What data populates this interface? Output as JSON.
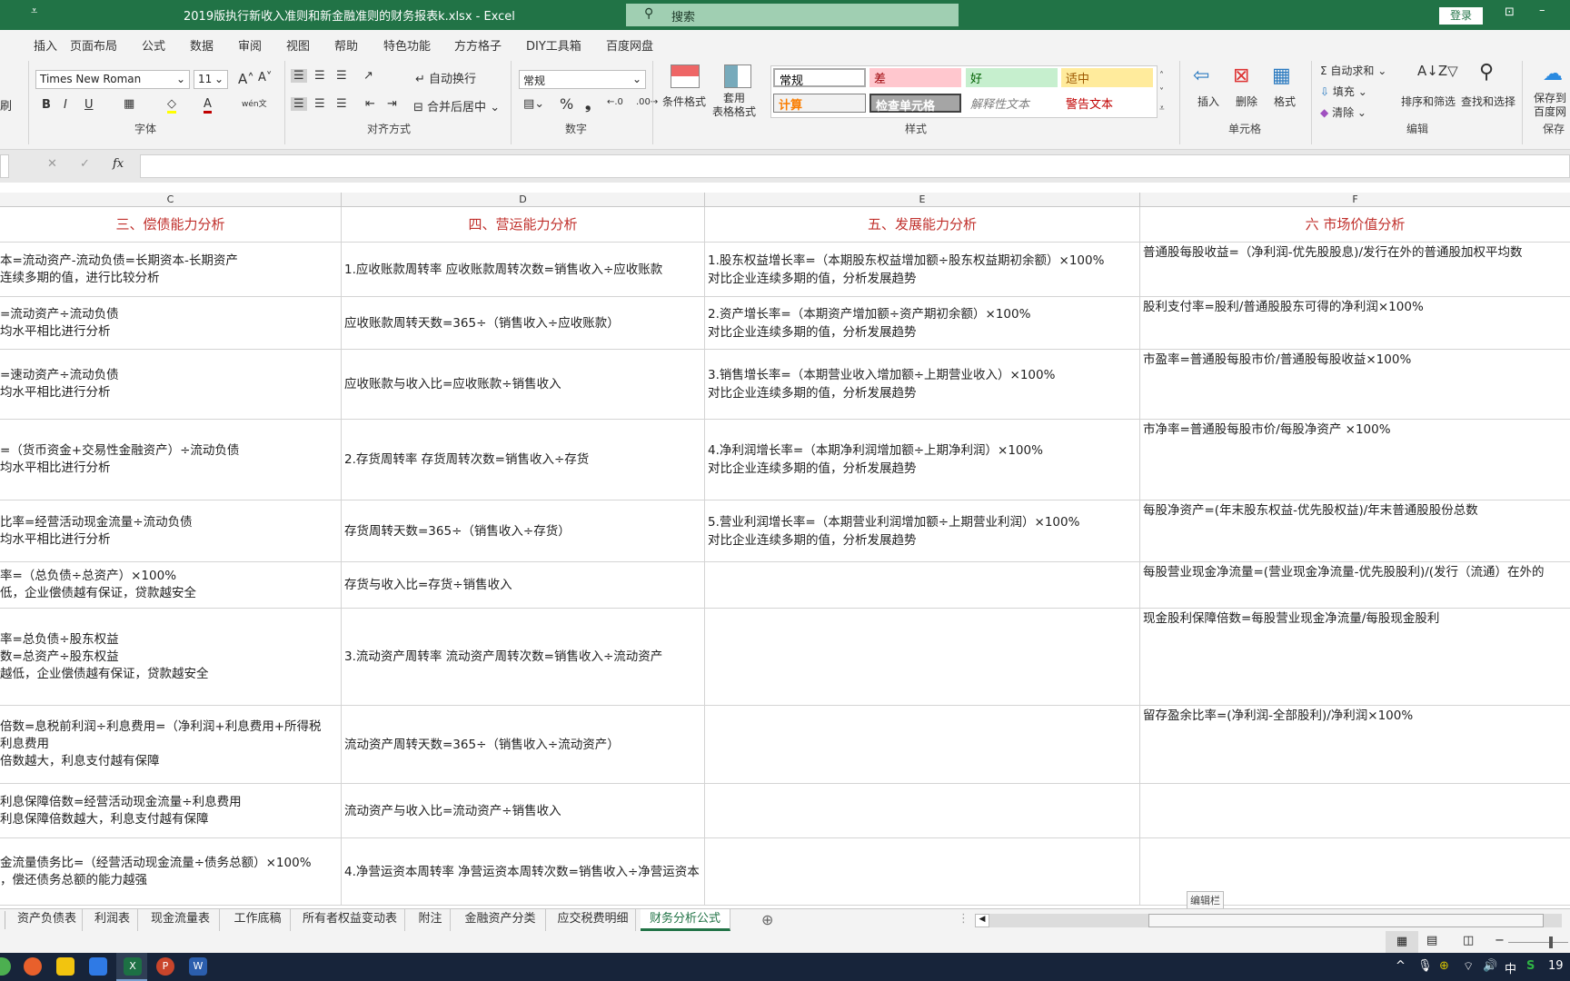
{
  "titlebar": {
    "title": "2019版执行新收入准则和新金融准则的财务报表k.xlsx  -  Excel",
    "search_placeholder": "搜索",
    "login": "登录",
    "qat_icon": "customize-qat-icon"
  },
  "menu": [
    "插入",
    "页面布局",
    "公式",
    "数据",
    "审阅",
    "视图",
    "帮助",
    "特色功能",
    "方方格子",
    "DIY工具箱",
    "百度网盘"
  ],
  "ribbon": {
    "clipboard_partial": "刷",
    "font": {
      "name": "Times New Roman",
      "size": "11",
      "group": "字体",
      "bold": "B",
      "italic": "I",
      "underline": "U",
      "wen": "wén文"
    },
    "alignment": {
      "wrap": "自动换行",
      "merge": "合并后居中",
      "group": "对齐方式"
    },
    "number": {
      "format": "常规",
      "percent": "%",
      "comma": "❟",
      "group": "数字"
    },
    "styles": {
      "cond_format": "条件格式",
      "table_format": "套用\n表格格式",
      "group": "样式",
      "gallery": [
        {
          "label": "常规",
          "bg": "#ffffff",
          "fg": "#000000"
        },
        {
          "label": "差",
          "bg": "#ffc7ce",
          "fg": "#9c0006"
        },
        {
          "label": "好",
          "bg": "#c6efce",
          "fg": "#006100"
        },
        {
          "label": "适中",
          "bg": "#ffeb9c",
          "fg": "#9c5700"
        },
        {
          "label": "计算",
          "bg": "#f2f2f2",
          "fg": "#fa7d00"
        },
        {
          "label": "检查单元格",
          "bg": "#a5a5a5",
          "fg": "#ffffff"
        },
        {
          "label": "解释性文本",
          "bg": "#ffffff",
          "fg": "#7f7f7f"
        },
        {
          "label": "警告文本",
          "bg": "#ffffff",
          "fg": "#c00000"
        }
      ]
    },
    "cells": {
      "insert": "插入",
      "delete": "删除",
      "format": "格式",
      "group": "单元格"
    },
    "editing": {
      "autosum": "自动求和",
      "fill": "填充",
      "clear": "清除",
      "sort": "排序和筛选",
      "find": "查找和选择",
      "group": "编辑"
    },
    "save": {
      "label": "保存到\n百度网",
      "group": "保存"
    }
  },
  "formula_bar": {
    "fx": "fx",
    "cancel": "✕",
    "enter": "✓",
    "value": ""
  },
  "columns": [
    "C",
    "D",
    "E",
    "F"
  ],
  "headers": [
    "三、偿债能力分析",
    "四、营运能力分析",
    "五、发展能力分析",
    "六 市场价值分析"
  ],
  "rows": [
    {
      "c": [
        "本=流动资产-流动负债=长期资本-长期资产",
        "连续多期的值，进行比较分析"
      ],
      "d": "1.应收账款周转率 应收账款周转次数=销售收入÷应收账款",
      "e": [
        "1.股东权益增长率=（本期股东权益增加额÷股东权益期初余额）×100%",
        "对比企业连续多期的值，分析发展趋势"
      ],
      "f": "普通股每股收益=（净利润-优先股股息)/发行在外的普通股加权平均数"
    },
    {
      "c": [
        "=流动资产÷流动负债",
        "均水平相比进行分析"
      ],
      "d": "应收账款周转天数=365÷（销售收入÷应收账款）",
      "e": [
        "2.资产增长率=（本期资产增加额÷资产期初余额）×100%",
        "对比企业连续多期的值，分析发展趋势"
      ],
      "f": "股利支付率=股利/普通股股东可得的净利润×100%"
    },
    {
      "c": [
        "=速动资产÷流动负债",
        "均水平相比进行分析"
      ],
      "d": "应收账款与收入比=应收账款÷销售收入",
      "e": [
        "3.销售增长率=（本期营业收入增加额÷上期营业收入）×100%",
        "对比企业连续多期的值，分析发展趋势"
      ],
      "f": "市盈率=普通股每股市价/普通股每股收益×100%"
    },
    {
      "c": [
        "=（货币资金+交易性金融资产）÷流动负债",
        "均水平相比进行分析"
      ],
      "d": "2.存货周转率 存货周转次数=销售收入÷存货",
      "e": [
        "4.净利润增长率=（本期净利润增加额÷上期净利润）×100%",
        " 对比企业连续多期的值，分析发展趋势"
      ],
      "f": "市净率=普通股每股市价/每股净资产 ×100%"
    },
    {
      "c": [
        "比率=经营活动现金流量÷流动负债",
        "均水平相比进行分析"
      ],
      "d": "存货周转天数=365÷（销售收入÷存货）",
      "e": [
        "5.营业利润增长率=（本期营业利润增加额÷上期营业利润）×100%",
        "对比企业连续多期的值，分析发展趋势"
      ],
      "f": "每股净资产=(年末股东权益-优先股权益)/年末普通股股份总数"
    },
    {
      "c": [
        "率=（总负债÷总资产）×100%",
        "低，企业偿债越有保证，贷款越安全"
      ],
      "d": "存货与收入比=存货÷销售收入",
      "e": [],
      "f": "每股营业现金净流量=(营业现金净流量-优先股股利)/(发行（流通）在外的"
    },
    {
      "c": [
        "率=总负债÷股东权益",
        "数=总资产÷股东权益",
        "越低，企业偿债越有保证，贷款越安全"
      ],
      "d": "3.流动资产周转率 流动资产周转次数=销售收入÷流动资产",
      "e": [],
      "f": "现金股利保障倍数=每股营业现金净流量/每股现金股利"
    },
    {
      "c": [
        "倍数=息税前利润÷利息费用=（净利润+利息费用+所得税",
        "利息费用",
        "倍数越大，利息支付越有保障"
      ],
      "d": "流动资产周转天数=365÷（销售收入÷流动资产）",
      "e": [],
      "f": "留存盈余比率=(净利润-全部股利)/净利润×100%"
    },
    {
      "c": [
        "利息保障倍数=经营活动现金流量÷利息费用",
        "利息保障倍数越大，利息支付越有保障"
      ],
      "d": "流动资产与收入比=流动资产÷销售收入",
      "e": [],
      "f": ""
    },
    {
      "c": [
        "金流量债务比=（经营活动现金流量÷债务总额）×100%",
        "，偿还债务总额的能力越强"
      ],
      "d": "4.净营运资本周转率 净营运资本周转次数=销售收入÷净营运资本",
      "e": [],
      "f": ""
    }
  ],
  "tooltip": "编辑栏",
  "sheet_tabs": [
    "资产负债表",
    "利润表",
    "现金流量表",
    "工作底稿",
    "所有者权益变动表",
    "附注",
    "金融资产分类",
    "应交税费明细",
    "财务分析公式"
  ],
  "active_sheet": "财务分析公式",
  "add_sheet": "⊕",
  "taskbar": {
    "ime": "中",
    "clock_partial": "19"
  },
  "colors": {
    "accent": "#217346",
    "header_text": "#c0302c",
    "taskbar": "#17243a"
  }
}
